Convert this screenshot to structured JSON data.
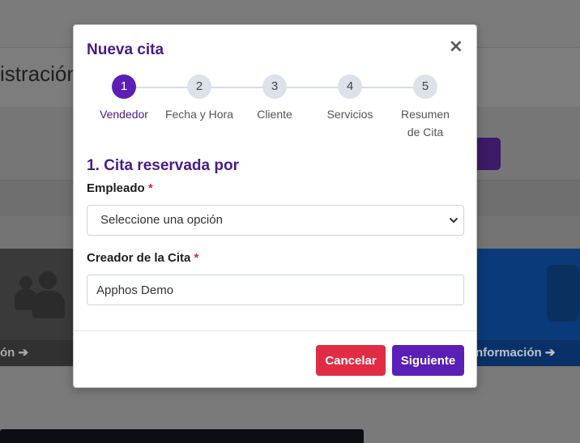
{
  "background": {
    "page_title_fragment": "istración",
    "card_left_link": "ón ➔",
    "card_right_link": "nformación ➔"
  },
  "modal": {
    "title": "Nueva cita",
    "close_symbol": "×",
    "steps": [
      {
        "number": "1",
        "label": "Vendedor",
        "active": true
      },
      {
        "number": "2",
        "label": "Fecha y Hora",
        "active": false
      },
      {
        "number": "3",
        "label": "Cliente",
        "active": false
      },
      {
        "number": "4",
        "label": "Servicios",
        "active": false
      },
      {
        "number": "5",
        "label": "Resumen de Cita",
        "active": false
      }
    ],
    "section_title": "1. Cita reservada por",
    "fields": {
      "employee_label": "Empleado",
      "employee_required": "*",
      "employee_value": "Seleccione una opción",
      "creator_label": "Creador de la Cita",
      "creator_required": "*",
      "creator_value": "Apphos Demo"
    },
    "buttons": {
      "cancel": "Cancelar",
      "next": "Siguiente"
    }
  },
  "colors": {
    "brand_purple": "#5b1fb5",
    "danger": "#e02d45"
  }
}
